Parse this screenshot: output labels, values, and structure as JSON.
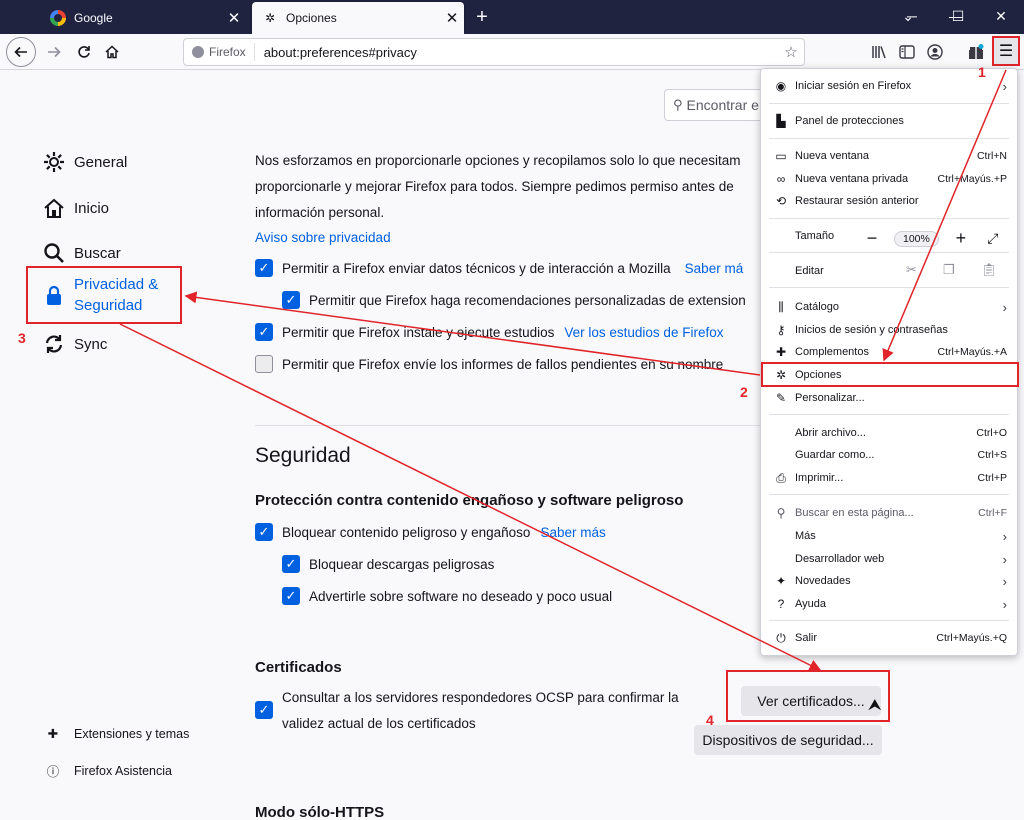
{
  "tabs": [
    {
      "title": "Google",
      "icon": "google-icon"
    },
    {
      "title": "Opciones",
      "icon": "gear-icon"
    }
  ],
  "urlbar": {
    "identity": "Firefox",
    "url": "about:preferences#privacy"
  },
  "search": {
    "placeholder": "Encontrar e"
  },
  "sidebar": {
    "items": [
      {
        "label": "General",
        "icon": "gear-icon"
      },
      {
        "label": "Inicio",
        "icon": "home-icon"
      },
      {
        "label": "Buscar",
        "icon": "search-icon"
      },
      {
        "label": "Privacidad &",
        "label2": "Seguridad",
        "icon": "lock-icon",
        "selected": true
      },
      {
        "label": "Sync",
        "icon": "sync-icon"
      }
    ],
    "footer": [
      {
        "label": "Extensiones y temas",
        "icon": "puzzle-icon"
      },
      {
        "label": "Firefox Asistencia",
        "icon": "help-icon"
      }
    ]
  },
  "data_collection": {
    "intro_1": "Nos esforzamos en proporcionarle opciones y recopilamos solo lo que necesitam",
    "intro_2": "proporcionarle y mejorar Firefox para todos. Siempre pedimos permiso antes de",
    "intro_3": "información personal.",
    "privacy_link": "Aviso sobre privacidad",
    "options": [
      {
        "label": "Permitir a Firefox enviar datos técnicos y de interacción a Mozilla",
        "link": "Saber má",
        "checked": true
      },
      {
        "label": "Permitir que Firefox haga recomendaciones personalizadas de extension",
        "checked": true
      },
      {
        "label": "Permitir que Firefox instale y ejecute estudios",
        "link": "Ver los estudios de Firefox",
        "checked": true
      },
      {
        "label": "Permitir que Firefox envíe los informes de fallos pendientes en su nombre",
        "checked": false
      }
    ]
  },
  "security": {
    "title": "Seguridad",
    "subtitle": "Protección contra contenido engañoso y software peligroso",
    "options": [
      {
        "label": "Bloquear contenido peligroso y engañoso",
        "link": "Saber más",
        "checked": true
      },
      {
        "label": "Bloquear descargas peligrosas",
        "checked": true
      },
      {
        "label": "Advertirle sobre software no deseado y poco usual",
        "checked": true
      }
    ]
  },
  "certificates": {
    "title": "Certificados",
    "ocsp_1": "Consultar a los servidores respondedores OCSP para confirmar la",
    "ocsp_2": "validez actual de los certificados",
    "view_button": "Ver certificados...",
    "devices_button": "Dispositivos de seguridad..."
  },
  "https_title": "Modo sólo-HTTPS",
  "menu": {
    "signin": "Iniciar sesión en Firefox",
    "protections": "Panel de protecciones",
    "new_window": {
      "label": "Nueva ventana",
      "shortcut": "Ctrl+N"
    },
    "private_window": {
      "label": "Nueva ventana privada",
      "shortcut": "Ctrl+Mayús.+P"
    },
    "restore": "Restaurar sesión anterior",
    "zoom_label": "Tamaño",
    "zoom_value": "100%",
    "edit_label": "Editar",
    "library": "Catálogo",
    "logins": "Inicios de sesión y contraseñas",
    "addons": {
      "label": "Complementos",
      "shortcut": "Ctrl+Mayús.+A"
    },
    "options": "Opciones",
    "customize": "Personalizar...",
    "open_file": {
      "label": "Abrir archivo...",
      "shortcut": "Ctrl+O"
    },
    "save_as": {
      "label": "Guardar como...",
      "shortcut": "Ctrl+S"
    },
    "print": {
      "label": "Imprimir...",
      "shortcut": "Ctrl+P"
    },
    "find": {
      "label": "Buscar en esta página...",
      "shortcut": "Ctrl+F"
    },
    "more": "Más",
    "webdev": "Desarrollador web",
    "whatsnew": "Novedades",
    "help": "Ayuda",
    "exit": {
      "label": "Salir",
      "shortcut": "Ctrl+Mayús.+Q"
    }
  },
  "annotations": {
    "step1": "1",
    "step2": "2",
    "step3": "3",
    "step4": "4",
    "color": "#e0242a"
  }
}
